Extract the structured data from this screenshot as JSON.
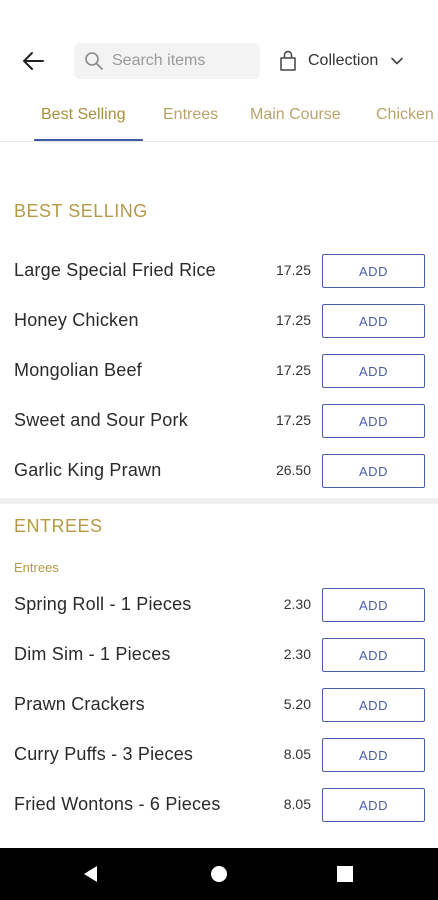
{
  "header": {
    "back_icon": "arrow-left-icon",
    "search": {
      "placeholder": "Search items",
      "value": ""
    },
    "order_type": {
      "label": "Collection",
      "icon": "shopping-bag-icon"
    }
  },
  "tabs": [
    {
      "label": "Best Selling",
      "active": true
    },
    {
      "label": "Entrees",
      "active": false
    },
    {
      "label": "Main Course",
      "active": false
    },
    {
      "label": "Chicken",
      "active": false
    }
  ],
  "sections": [
    {
      "title": "BEST SELLING",
      "subcategory": "",
      "items": [
        {
          "name": "Large Special Fried Rice",
          "price": "17.25",
          "button": "ADD"
        },
        {
          "name": "Honey Chicken",
          "price": "17.25",
          "button": "ADD"
        },
        {
          "name": "Mongolian Beef",
          "price": "17.25",
          "button": "ADD"
        },
        {
          "name": "Sweet and Sour Pork",
          "price": "17.25",
          "button": "ADD"
        },
        {
          "name": "Garlic King Prawn",
          "price": "26.50",
          "button": "ADD"
        }
      ]
    },
    {
      "title": "ENTREES",
      "subcategory": "Entrees",
      "items": [
        {
          "name": "Spring Roll - 1 Pieces",
          "price": "2.30",
          "button": "ADD"
        },
        {
          "name": "Dim Sim - 1 Pieces",
          "price": "2.30",
          "button": "ADD"
        },
        {
          "name": "Prawn Crackers",
          "price": "5.20",
          "button": "ADD"
        },
        {
          "name": "Curry Puffs - 3 Pieces",
          "price": "8.05",
          "button": "ADD"
        },
        {
          "name": "Fried Wontons - 6 Pieces",
          "price": "8.05",
          "button": "ADD"
        }
      ]
    }
  ],
  "colors": {
    "accent_gold": "#b59a45",
    "button_blue": "#4a5ea8",
    "tab_underline": "#3f5aa8"
  }
}
